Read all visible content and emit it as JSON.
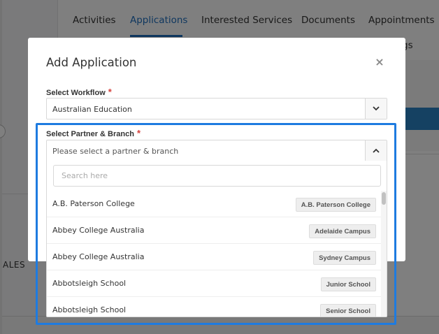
{
  "background": {
    "tabs": [
      {
        "label": "Activities",
        "active": false
      },
      {
        "label": "Applications",
        "active": true
      },
      {
        "label": "Interested Services",
        "active": false
      },
      {
        "label": "Documents",
        "active": false
      },
      {
        "label": "Appointments",
        "active": false
      }
    ],
    "tab_second_row_fragment": "gs",
    "sidebar_fragment": "ALES"
  },
  "modal": {
    "title": "Add Application",
    "close_icon": "×",
    "workflow": {
      "label": "Select Workflow",
      "required_mark": "*",
      "value": "Australian Education"
    },
    "partner": {
      "label": "Select Partner & Branch",
      "required_mark": "*",
      "placeholder": "Please select a partner & branch",
      "search_placeholder": "Search here",
      "options": [
        {
          "name": "A.B. Paterson College",
          "branch": "A.B. Paterson College"
        },
        {
          "name": "Abbey College Australia",
          "branch": "Adelaide Campus"
        },
        {
          "name": "Abbey College Australia",
          "branch": "Sydney Campus"
        },
        {
          "name": "Abbotsleigh School",
          "branch": "Junior School"
        },
        {
          "name": "Abbotsleigh School",
          "branch": "Senior School"
        }
      ]
    }
  },
  "colors": {
    "accent": "#1f6fbf",
    "highlight": "#1e7be0",
    "required": "#d43f3a"
  }
}
